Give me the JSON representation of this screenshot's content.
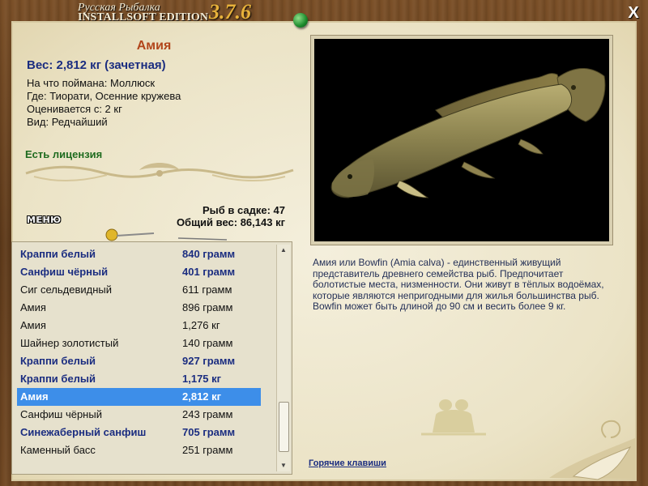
{
  "app": {
    "title_rus": "Русская Рыбалка",
    "title_edition": "INSTALLSOFT EDITION",
    "version": "3.7.6",
    "close_label": "X"
  },
  "fish": {
    "name": "Амия",
    "weight": "Вес: 2,812 кг (зачетная)",
    "caught_on": "На что поймана: Моллюск",
    "where": "Где: Тиорати, Осенние кружева",
    "rated_from": "Оценивается с: 2 кг",
    "kind": "Вид: Редчайший",
    "license": "Есть лицензия"
  },
  "keepnet": {
    "count": "Рыб в садке: 47",
    "total": "Общий вес: 86,143 кг"
  },
  "menu_label": "МЕНЮ",
  "description": "Амия или Bowfin (Amia calva) - единственный живущий представитель древнего семейства рыб. Предпочитает болотистые места, низменности. Они живут в тёплых водоёмах, которые являются непригодными для жилья большинства рыб. Bowfin может быть длиной до 90 см и весить более 9 кг.",
  "hotkeys_label": "Горячие клавиши",
  "catch_list": [
    {
      "name": "Краппи белый",
      "weight": "840 грамм",
      "bold": true
    },
    {
      "name": "Санфиш чёрный",
      "weight": "401 грамм",
      "bold": true
    },
    {
      "name": "Сиг сельдевидный",
      "weight": "611 грамм",
      "bold": false
    },
    {
      "name": "Амия",
      "weight": "896 грамм",
      "bold": false
    },
    {
      "name": "Амия",
      "weight": "1,276 кг",
      "bold": false
    },
    {
      "name": "Шайнер золотистый",
      "weight": "140 грамм",
      "bold": false
    },
    {
      "name": "Краппи белый",
      "weight": "927 грамм",
      "bold": true
    },
    {
      "name": "Краппи белый",
      "weight": "1,175 кг",
      "bold": true
    },
    {
      "name": "Амия",
      "weight": "2,812 кг",
      "bold": true,
      "selected": true
    },
    {
      "name": "Санфиш чёрный",
      "weight": "243 грамм",
      "bold": false
    },
    {
      "name": "Синежаберный санфиш",
      "weight": "705 грамм",
      "bold": true
    },
    {
      "name": "Каменный басс",
      "weight": "251 грамм",
      "bold": false
    }
  ],
  "colors": {
    "name": "#b2461b",
    "weight": "#1b2d80",
    "license": "#1f6b1f",
    "selection": "#3d8ee9"
  }
}
